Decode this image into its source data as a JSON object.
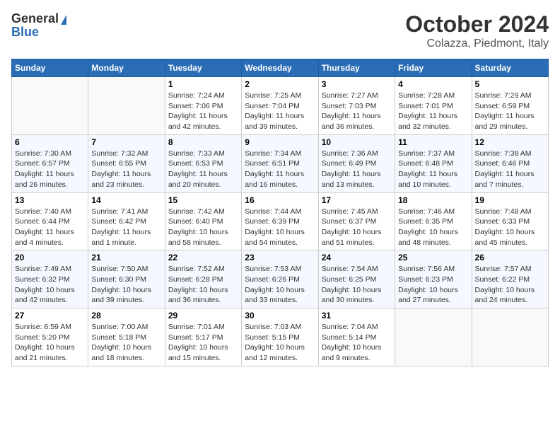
{
  "header": {
    "logo_general": "General",
    "logo_blue": "Blue",
    "month_title": "October 2024",
    "location": "Colazza, Piedmont, Italy"
  },
  "days_of_week": [
    "Sunday",
    "Monday",
    "Tuesday",
    "Wednesday",
    "Thursday",
    "Friday",
    "Saturday"
  ],
  "weeks": [
    [
      {
        "day": "",
        "info": ""
      },
      {
        "day": "",
        "info": ""
      },
      {
        "day": "1",
        "info": "Sunrise: 7:24 AM\nSunset: 7:06 PM\nDaylight: 11 hours and 42 minutes."
      },
      {
        "day": "2",
        "info": "Sunrise: 7:25 AM\nSunset: 7:04 PM\nDaylight: 11 hours and 39 minutes."
      },
      {
        "day": "3",
        "info": "Sunrise: 7:27 AM\nSunset: 7:03 PM\nDaylight: 11 hours and 36 minutes."
      },
      {
        "day": "4",
        "info": "Sunrise: 7:28 AM\nSunset: 7:01 PM\nDaylight: 11 hours and 32 minutes."
      },
      {
        "day": "5",
        "info": "Sunrise: 7:29 AM\nSunset: 6:59 PM\nDaylight: 11 hours and 29 minutes."
      }
    ],
    [
      {
        "day": "6",
        "info": "Sunrise: 7:30 AM\nSunset: 6:57 PM\nDaylight: 11 hours and 26 minutes."
      },
      {
        "day": "7",
        "info": "Sunrise: 7:32 AM\nSunset: 6:55 PM\nDaylight: 11 hours and 23 minutes."
      },
      {
        "day": "8",
        "info": "Sunrise: 7:33 AM\nSunset: 6:53 PM\nDaylight: 11 hours and 20 minutes."
      },
      {
        "day": "9",
        "info": "Sunrise: 7:34 AM\nSunset: 6:51 PM\nDaylight: 11 hours and 16 minutes."
      },
      {
        "day": "10",
        "info": "Sunrise: 7:36 AM\nSunset: 6:49 PM\nDaylight: 11 hours and 13 minutes."
      },
      {
        "day": "11",
        "info": "Sunrise: 7:37 AM\nSunset: 6:48 PM\nDaylight: 11 hours and 10 minutes."
      },
      {
        "day": "12",
        "info": "Sunrise: 7:38 AM\nSunset: 6:46 PM\nDaylight: 11 hours and 7 minutes."
      }
    ],
    [
      {
        "day": "13",
        "info": "Sunrise: 7:40 AM\nSunset: 6:44 PM\nDaylight: 11 hours and 4 minutes."
      },
      {
        "day": "14",
        "info": "Sunrise: 7:41 AM\nSunset: 6:42 PM\nDaylight: 11 hours and 1 minute."
      },
      {
        "day": "15",
        "info": "Sunrise: 7:42 AM\nSunset: 6:40 PM\nDaylight: 10 hours and 58 minutes."
      },
      {
        "day": "16",
        "info": "Sunrise: 7:44 AM\nSunset: 6:39 PM\nDaylight: 10 hours and 54 minutes."
      },
      {
        "day": "17",
        "info": "Sunrise: 7:45 AM\nSunset: 6:37 PM\nDaylight: 10 hours and 51 minutes."
      },
      {
        "day": "18",
        "info": "Sunrise: 7:46 AM\nSunset: 6:35 PM\nDaylight: 10 hours and 48 minutes."
      },
      {
        "day": "19",
        "info": "Sunrise: 7:48 AM\nSunset: 6:33 PM\nDaylight: 10 hours and 45 minutes."
      }
    ],
    [
      {
        "day": "20",
        "info": "Sunrise: 7:49 AM\nSunset: 6:32 PM\nDaylight: 10 hours and 42 minutes."
      },
      {
        "day": "21",
        "info": "Sunrise: 7:50 AM\nSunset: 6:30 PM\nDaylight: 10 hours and 39 minutes."
      },
      {
        "day": "22",
        "info": "Sunrise: 7:52 AM\nSunset: 6:28 PM\nDaylight: 10 hours and 36 minutes."
      },
      {
        "day": "23",
        "info": "Sunrise: 7:53 AM\nSunset: 6:26 PM\nDaylight: 10 hours and 33 minutes."
      },
      {
        "day": "24",
        "info": "Sunrise: 7:54 AM\nSunset: 6:25 PM\nDaylight: 10 hours and 30 minutes."
      },
      {
        "day": "25",
        "info": "Sunrise: 7:56 AM\nSunset: 6:23 PM\nDaylight: 10 hours and 27 minutes."
      },
      {
        "day": "26",
        "info": "Sunrise: 7:57 AM\nSunset: 6:22 PM\nDaylight: 10 hours and 24 minutes."
      }
    ],
    [
      {
        "day": "27",
        "info": "Sunrise: 6:59 AM\nSunset: 5:20 PM\nDaylight: 10 hours and 21 minutes."
      },
      {
        "day": "28",
        "info": "Sunrise: 7:00 AM\nSunset: 5:18 PM\nDaylight: 10 hours and 18 minutes."
      },
      {
        "day": "29",
        "info": "Sunrise: 7:01 AM\nSunset: 5:17 PM\nDaylight: 10 hours and 15 minutes."
      },
      {
        "day": "30",
        "info": "Sunrise: 7:03 AM\nSunset: 5:15 PM\nDaylight: 10 hours and 12 minutes."
      },
      {
        "day": "31",
        "info": "Sunrise: 7:04 AM\nSunset: 5:14 PM\nDaylight: 10 hours and 9 minutes."
      },
      {
        "day": "",
        "info": ""
      },
      {
        "day": "",
        "info": ""
      }
    ]
  ]
}
